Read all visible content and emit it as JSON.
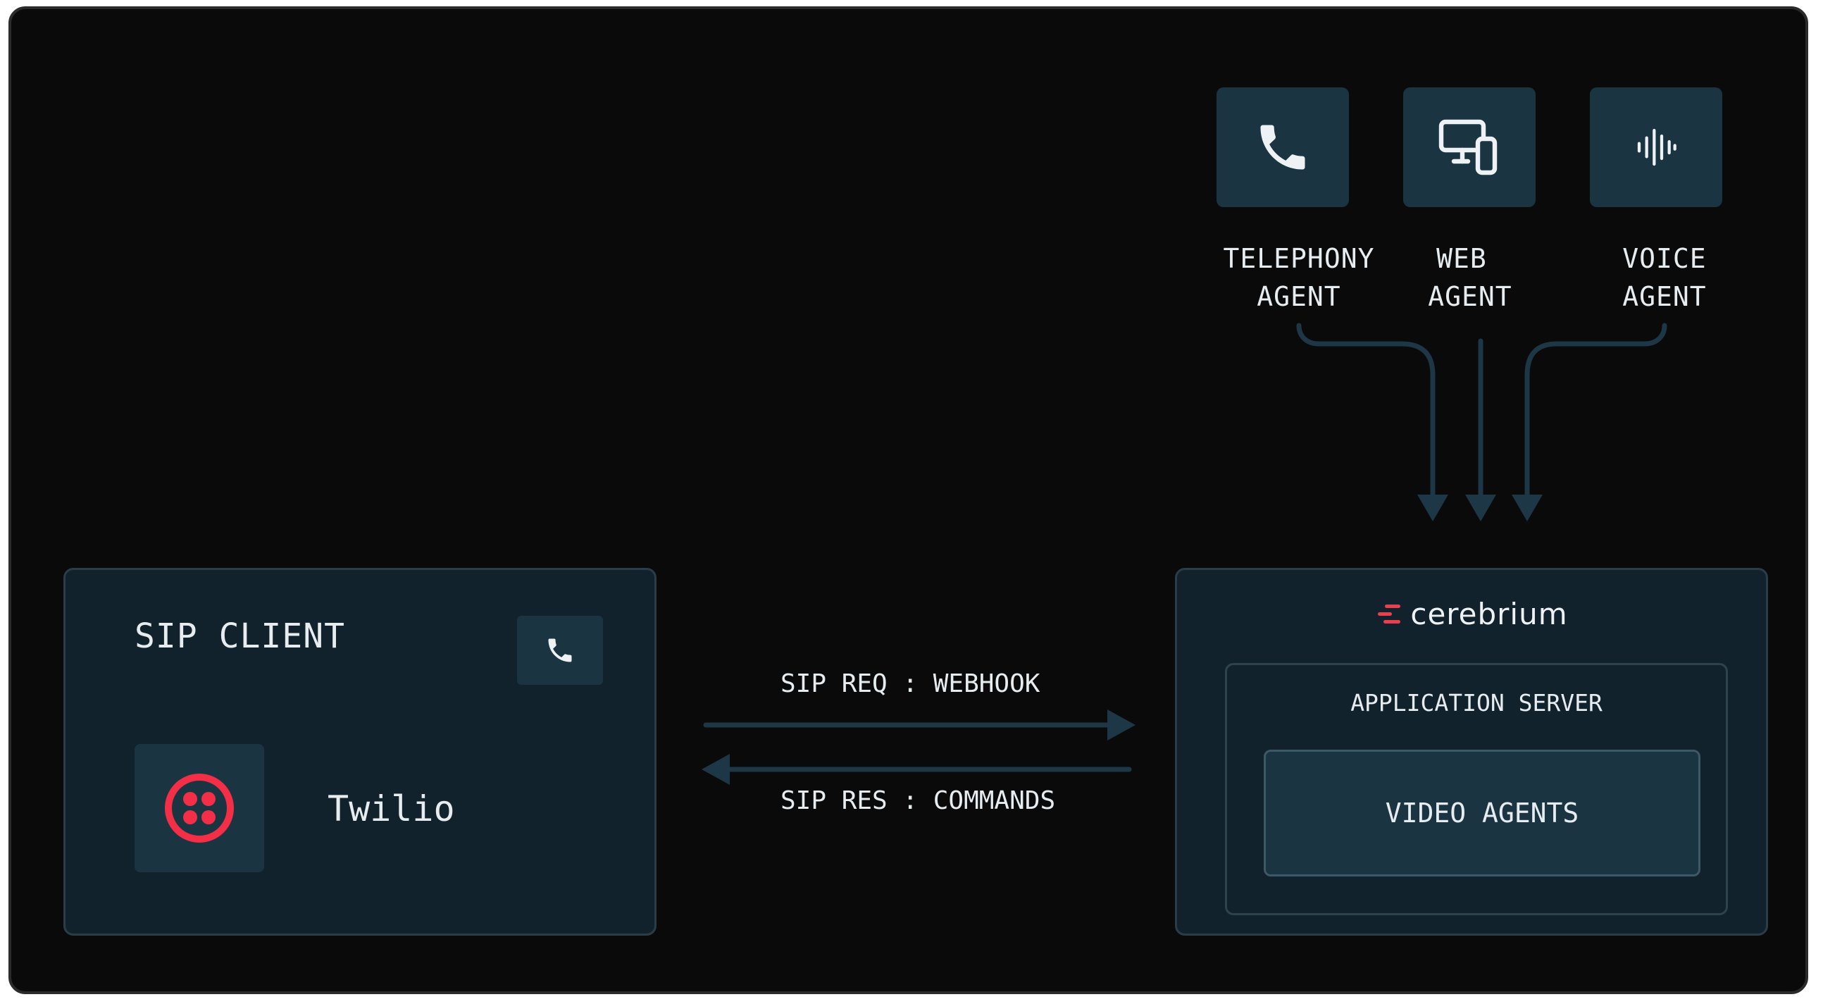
{
  "agents": [
    {
      "line1": "TELEPHONY",
      "line2": "AGENT",
      "icon": "phone-icon"
    },
    {
      "line1": "WEB",
      "line2": "AGENT",
      "icon": "devices-icon"
    },
    {
      "line1": "VOICE",
      "line2": "AGENT",
      "icon": "audio-wave-icon"
    }
  ],
  "sip_client": {
    "title": "SIP CLIENT",
    "provider": "Twilio",
    "badge_icon": "phone-icon",
    "logo_icon": "twilio-logo-icon"
  },
  "arrows": {
    "request": "SIP REQ : WEBHOOK",
    "response": "SIP RES : COMMANDS"
  },
  "cerebrium": {
    "brand": "cerebrium",
    "application_server": "APPLICATION SERVER",
    "video_agents": "VIDEO AGENTS"
  },
  "colors": {
    "background": "#0a0a0a",
    "panel": "#12222d",
    "tile": "#1b3442",
    "connector": "#1d3746",
    "twilio_red": "#f22f46",
    "brand_red": "#e8404f",
    "text": "#e6ecef"
  }
}
